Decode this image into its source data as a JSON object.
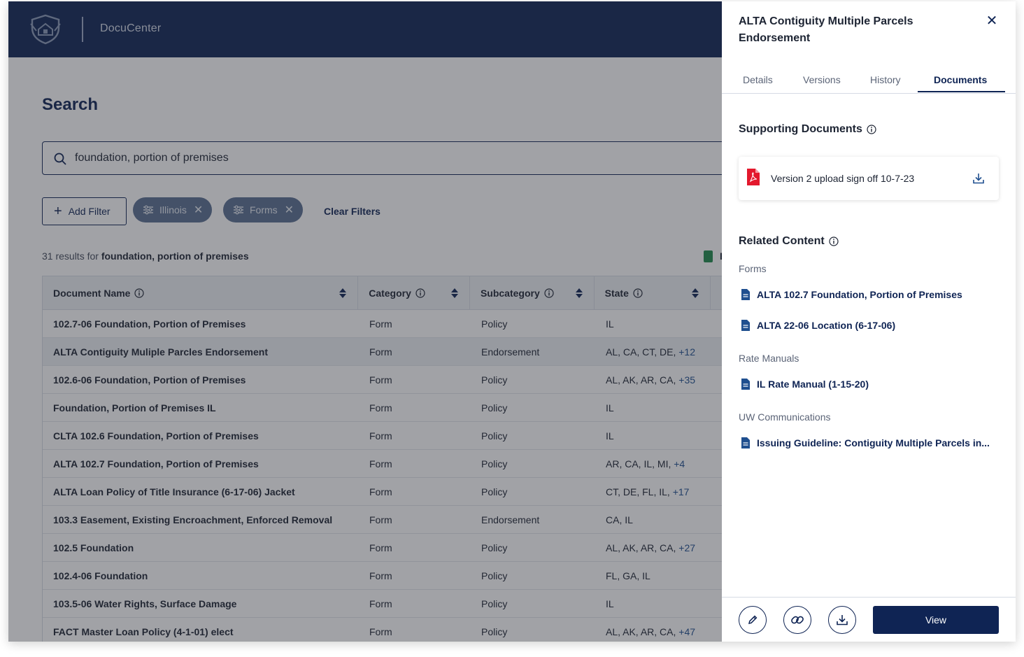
{
  "header": {
    "app_name": "DocuCenter",
    "logo": "shield-logo"
  },
  "search": {
    "title": "Search",
    "query": "foundation, portion of premises",
    "add_filter_label": "Add Filter",
    "filters": [
      {
        "label": "Illinois",
        "icon": "sliders-icon"
      },
      {
        "label": "Forms",
        "icon": "sliders-icon"
      }
    ],
    "clear_filters_label": "Clear Filters",
    "results_prefix": "31 results for",
    "results_query": "foundation, portion of premises",
    "export_partial": "E"
  },
  "table": {
    "columns": [
      "Document Name",
      "Category",
      "Subcategory",
      "State"
    ],
    "rows": [
      {
        "name": "102.7-06 Foundation, Portion of Premises",
        "category": "Form",
        "subcategory": "Policy",
        "state": "IL",
        "more": ""
      },
      {
        "name": "ALTA Contiguity Muliple Parcles Endorsement",
        "category": "Form",
        "subcategory": "Endorsement",
        "state": "AL, CA, CT, DE,",
        "more": "+12"
      },
      {
        "name": "102.6-06 Foundation, Portion of Premises",
        "category": "Form",
        "subcategory": "Policy",
        "state": "AL, AK, AR, CA,",
        "more": "+35"
      },
      {
        "name": "Foundation, Portion of Premises IL",
        "category": "Form",
        "subcategory": "Policy",
        "state": "IL",
        "more": ""
      },
      {
        "name": "CLTA 102.6 Foundation, Portion of Premises",
        "category": "Form",
        "subcategory": "Policy",
        "state": "IL",
        "more": ""
      },
      {
        "name": "ALTA 102.7 Foundation, Portion of Premises",
        "category": "Form",
        "subcategory": "Policy",
        "state": "AR, CA, IL, MI,",
        "more": "+4"
      },
      {
        "name": "ALTA Loan Policy of Title Insurance (6-17-06) Jacket",
        "category": "Form",
        "subcategory": "Policy",
        "state": "CT, DE, FL, IL,",
        "more": "+17"
      },
      {
        "name": "103.3 Easement, Existing Encroachment, Enforced Removal",
        "category": "Form",
        "subcategory": "Endorsement",
        "state": "CA, IL",
        "more": ""
      },
      {
        "name": "102.5 Foundation",
        "category": "Form",
        "subcategory": "Policy",
        "state": "AL, AK, AR, CA,",
        "more": "+27"
      },
      {
        "name": "102.4-06 Foundation",
        "category": "Form",
        "subcategory": "Policy",
        "state": "FL, GA, IL",
        "more": ""
      },
      {
        "name": "103.5-06 Water Rights, Surface Damage",
        "category": "Form",
        "subcategory": "Policy",
        "state": "IL",
        "more": ""
      },
      {
        "name": "FACT Master Loan Policy (4-1-01) elect",
        "category": "Form",
        "subcategory": "Policy",
        "state": "AL, AK, AR, CA,",
        "more": "+47"
      }
    ]
  },
  "panel": {
    "title": "ALTA Contiguity Multiple Parcels Endorsement",
    "close_icon": "close-icon",
    "tabs": [
      "Details",
      "Versions",
      "History",
      "Documents"
    ],
    "active_tab": "Documents",
    "supporting_title": "Supporting Documents",
    "supporting_doc": "Version 2 upload sign off 10-7-23",
    "related_title": "Related Content",
    "groups": [
      {
        "label": "Forms",
        "items": [
          "ALTA 102.7 Foundation, Portion of Premises",
          "ALTA 22-06 Location (6-17-06)"
        ]
      },
      {
        "label": "Rate Manuals",
        "items": [
          "IL Rate Manual (1-15-20)"
        ]
      },
      {
        "label": "UW Communications",
        "items": [
          "Issuing Guideline: Contiguity Multiple Parcels in..."
        ]
      }
    ],
    "footer": {
      "edit_icon": "pencil-icon",
      "link_icon": "link-icon",
      "download_icon": "download-icon",
      "view_label": "View"
    }
  },
  "colors": {
    "navy": "#0f2454",
    "chip": "#5a6f91",
    "pdf_red": "#e3182d",
    "csv_green": "#1f8a4c"
  }
}
